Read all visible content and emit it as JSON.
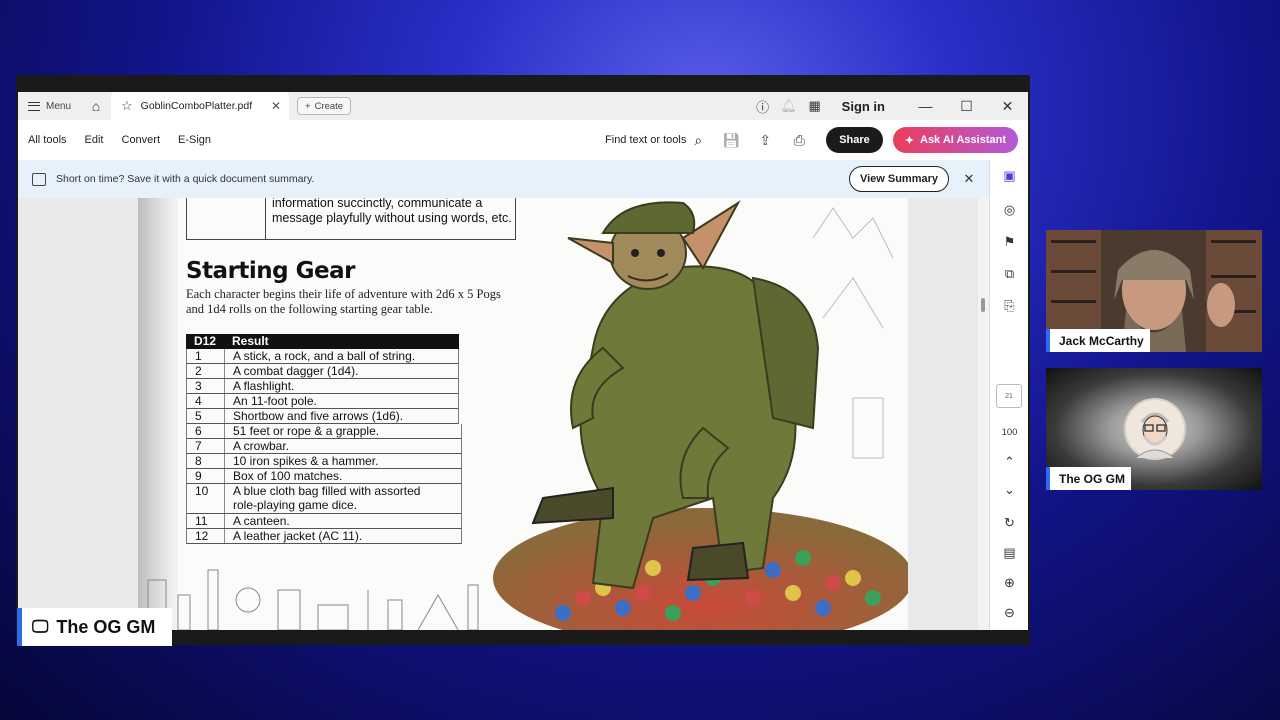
{
  "titlebar": {
    "menu_label": "Menu",
    "tab_title": "GoblinComboPlatter.pdf",
    "create_label": "Create",
    "signin_label": "Sign in"
  },
  "toolbar": {
    "all_tools": "All tools",
    "edit": "Edit",
    "convert": "Convert",
    "esign": "E-Sign",
    "find_label": "Find text or tools",
    "share_label": "Share",
    "ai_label": "Ask AI Assistant"
  },
  "banner": {
    "text": "Short on time? Save it with a quick document summary.",
    "button": "View Summary"
  },
  "document": {
    "prev_text": "information succinctly, communicate a message playfully without using words, etc.",
    "heading": "Starting Gear",
    "intro": "Each character begins their life of adventure with 2d6 x 5 Pogs and 1d4 rolls on the following starting gear table.",
    "table": {
      "headers": [
        "D12",
        "Result"
      ],
      "rows": [
        [
          "1",
          "A stick, a rock, and a ball of string."
        ],
        [
          "2",
          "A combat dagger (1d4)."
        ],
        [
          "3",
          "A flashlight."
        ],
        [
          "4",
          "An 11-foot pole."
        ],
        [
          "5",
          "Shortbow and five arrows (1d6)."
        ],
        [
          "6",
          "51 feet or rope & a grapple."
        ],
        [
          "7",
          "A crowbar."
        ],
        [
          "8",
          "10 iron spikes & a hammer."
        ],
        [
          "9",
          "Box of 100 matches."
        ],
        [
          "10",
          "A blue cloth bag filled with assorted role-playing game dice."
        ],
        [
          "11",
          "A canteen."
        ],
        [
          "12",
          "A leather jacket (AC 11)."
        ]
      ]
    }
  },
  "rightrail": {
    "page_indicator": "21",
    "zoom": "100"
  },
  "participants": [
    {
      "name": "Jack McCarthy"
    },
    {
      "name": "The OG GM"
    }
  ],
  "host_label": "The OG GM",
  "colors": {
    "accent_blue": "#2d6cf0",
    "ai_gradient_start": "#ec3d5b",
    "ai_gradient_end": "#b25ad9",
    "banner_bg": "#e6f1fb"
  }
}
